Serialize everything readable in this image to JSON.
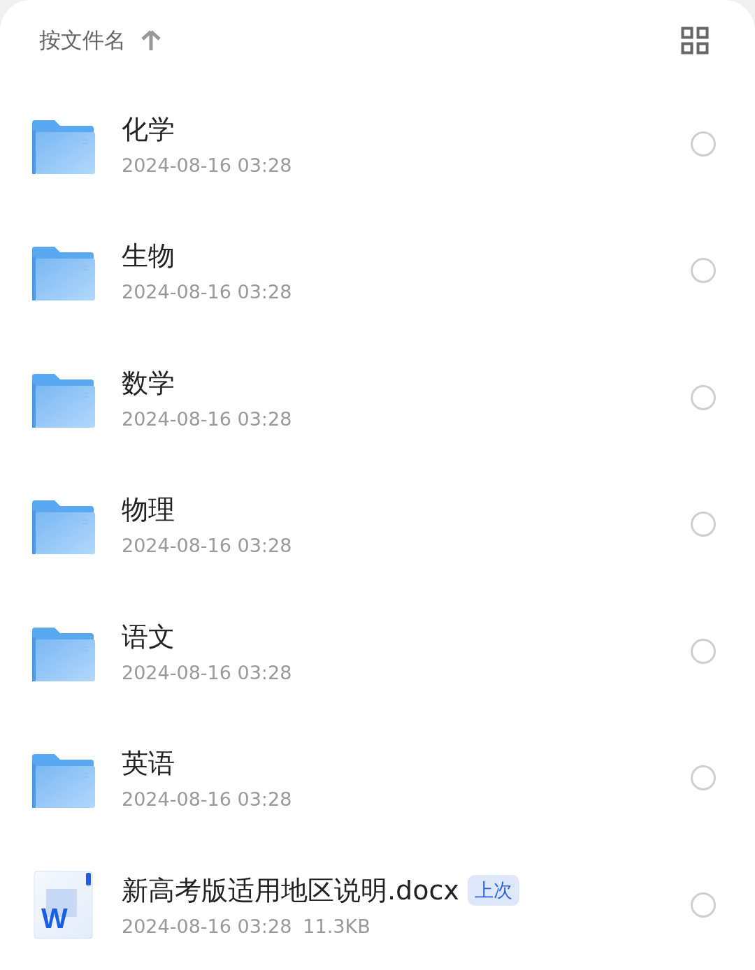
{
  "sort_bar": {
    "label": "按文件名",
    "ascending": true
  },
  "items": [
    {
      "kind": "folder",
      "name": "化学",
      "date": "2024-08-16 03:28",
      "selected": false
    },
    {
      "kind": "folder",
      "name": "生物",
      "date": "2024-08-16 03:28",
      "selected": false
    },
    {
      "kind": "folder",
      "name": "数学",
      "date": "2024-08-16 03:28",
      "selected": false
    },
    {
      "kind": "folder",
      "name": "物理",
      "date": "2024-08-16 03:28",
      "selected": false
    },
    {
      "kind": "folder",
      "name": "语文",
      "date": "2024-08-16 03:28",
      "selected": false
    },
    {
      "kind": "folder",
      "name": "英语",
      "date": "2024-08-16 03:28",
      "selected": false
    },
    {
      "kind": "document",
      "icon_letter": "W",
      "name": "新高考版适用地区说明.docx",
      "badge": "上次",
      "date": "2024-08-16 03:28",
      "size": "11.3KB",
      "selected": false
    }
  ]
}
